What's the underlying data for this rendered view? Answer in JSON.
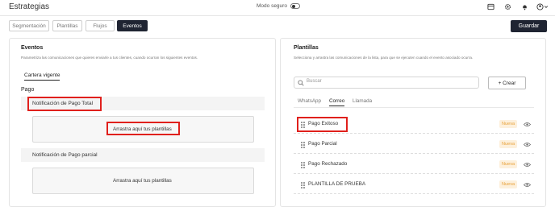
{
  "header": {
    "title": "Estrategias",
    "safe_mode_label": "Modo seguro",
    "icons": [
      "store-icon",
      "gear-icon",
      "bell-icon",
      "user-icon",
      "chevron-down-icon"
    ]
  },
  "tabs": [
    {
      "label": "Segmentación",
      "active": false
    },
    {
      "label": "Plantillas",
      "active": false
    },
    {
      "label": "Flujos",
      "active": false
    },
    {
      "label": "Eventos",
      "active": true
    }
  ],
  "save_label": "Guardar",
  "events_panel": {
    "title": "Eventos",
    "subtitle": "Parametriza las comunicaciones que quieres enviarle a tus clientes, cuando ocurran los siguientes eventos.",
    "section_tab": "Cartera vigente",
    "group_label": "Pago",
    "events": [
      {
        "name": "Notificación de Pago Total",
        "dropzone_text": "Arrastra aquí tus plantillas"
      },
      {
        "name": "Notificación de Pago parcial",
        "dropzone_text": "Arrastra aquí tus plantillas"
      }
    ]
  },
  "templates_panel": {
    "title": "Plantillas",
    "subtitle": "Selecciona y arrastra las comunicaciones de la lista, para que se ejecuten cuando el evento asociado ocurra.",
    "search_placeholder": "Buscar",
    "create_label": "+ Crear",
    "channels": [
      {
        "label": "WhatsApp",
        "active": false
      },
      {
        "label": "Correo",
        "active": true
      },
      {
        "label": "Llamada",
        "active": false
      }
    ],
    "templates": [
      {
        "name": "Pago Exitoso",
        "badge": "Nueva"
      },
      {
        "name": "Pago Parcial",
        "badge": "Nueva"
      },
      {
        "name": "Pago Rechazado",
        "badge": "Nueva"
      },
      {
        "name": "PLANTILLA DE PRUEBA",
        "badge": "Nueva"
      }
    ]
  },
  "colors": {
    "dark": "#1f2432",
    "highlight": "#e0201c",
    "badge_bg": "#fdf0dc",
    "badge_text": "#e8a13a"
  }
}
